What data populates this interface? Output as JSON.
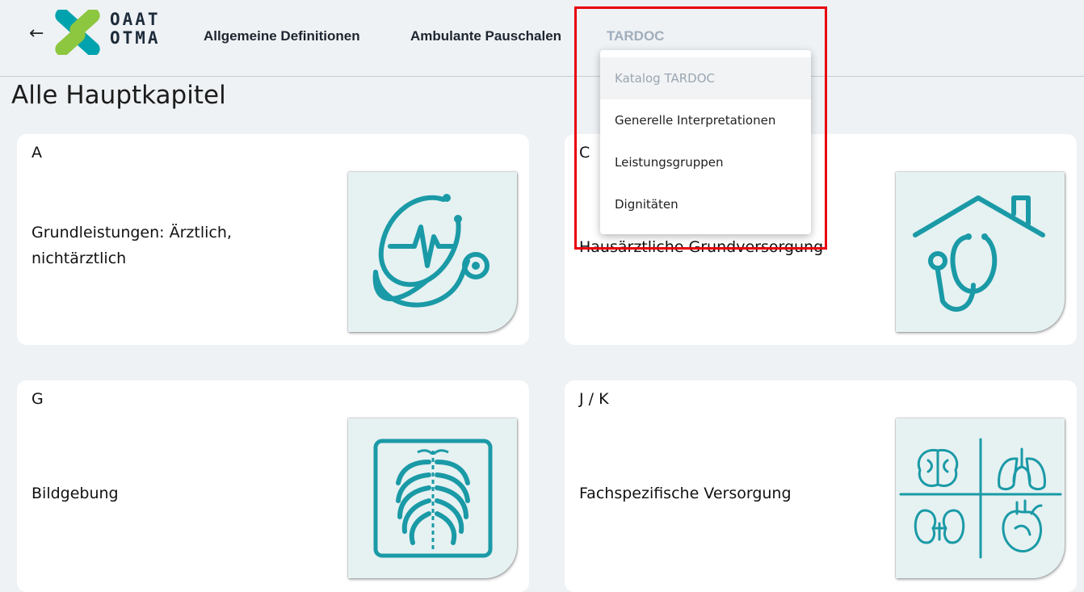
{
  "header": {
    "back_icon": "arrow-left-icon",
    "logo": {
      "line1": "OAAT",
      "line2": "OTMA",
      "colors": [
        "#00a3ad",
        "#8dc63f"
      ]
    },
    "nav": [
      {
        "label": "Allgemeine Definitionen"
      },
      {
        "label": "Ambulante Pauschalen"
      },
      {
        "label": "TARDOC",
        "active": true
      }
    ]
  },
  "dropdown": {
    "items": [
      {
        "label": "Katalog TARDOC",
        "selected": true
      },
      {
        "label": "Generelle Interpretationen"
      },
      {
        "label": "Leistungsgruppen"
      },
      {
        "label": "Dignitäten"
      }
    ]
  },
  "page": {
    "title": "Alle Hauptkapitel"
  },
  "chapters": [
    {
      "letter": "A",
      "title_lines": [
        "Grundleistungen: Ärztlich,",
        "nichtärztlich"
      ],
      "icon": "stethoscope-heartbeat-icon"
    },
    {
      "letter": "C",
      "title_lines": [
        "Hausärztliche Grundversorgung"
      ],
      "icon": "house-stethoscope-icon"
    },
    {
      "letter": "G",
      "title_lines": [
        "Bildgebung"
      ],
      "icon": "xray-ribcage-icon"
    },
    {
      "letter": "J / K",
      "title_lines": [
        "Fachspezifische Versorgung"
      ],
      "icon": "organs-icon"
    }
  ],
  "colors": {
    "accent": "#1a9aa6",
    "illustration_bg": "#e6f1f2",
    "highlight": "#e8000b",
    "page_bg": "#eef2f5"
  }
}
